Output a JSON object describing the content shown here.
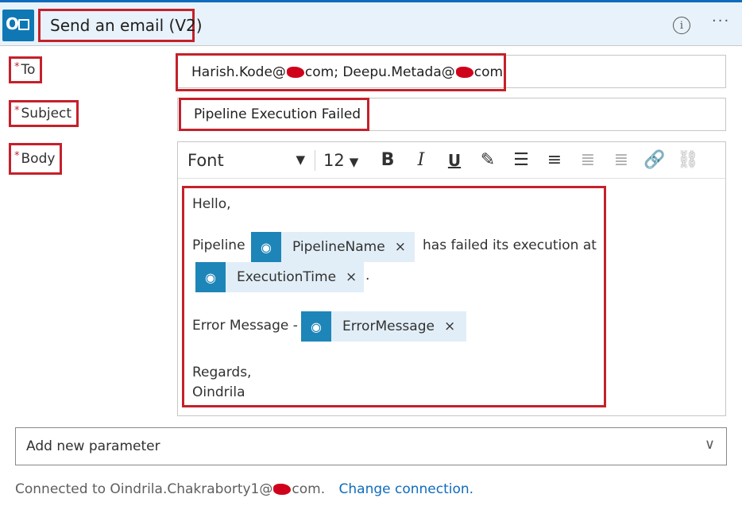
{
  "header": {
    "title": "Send an email (V2)",
    "app_icon": "outlook-icon",
    "info_glyph": "i",
    "more_glyph": "···"
  },
  "fields": {
    "to": {
      "label": "To",
      "required_mark": "*",
      "value_part1": "Harish.Kode@",
      "value_part2": "com; Deepu.Metada@",
      "value_part3": "com"
    },
    "subject": {
      "label": "Subject",
      "required_mark": "*",
      "value": "Pipeline Execution Failed"
    },
    "body": {
      "label": "Body",
      "required_mark": "*"
    }
  },
  "toolbar": {
    "font": "Font",
    "size": "12",
    "caret": "▼",
    "bold": "B",
    "italic": "I",
    "underline": "U",
    "pen": "✎",
    "bullets": "☰",
    "numbered": "≡",
    "outdent": "≣",
    "indent": "≣",
    "link": "🔗",
    "unlink": "⛓"
  },
  "body_content": {
    "greeting": "Hello,",
    "pipeline_prefix": "Pipeline",
    "pipeline_suffix": "has failed its execution at",
    "period": ".",
    "error_prefix": "Error Message -",
    "regards": "Regards,",
    "signature": "Oindrila",
    "tokens": {
      "pipeline_name": "PipelineName",
      "execution_time": "ExecutionTime",
      "error_message": "ErrorMessage",
      "remove_glyph": "×",
      "icon": "dynamic-content-icon"
    }
  },
  "add_parameter": {
    "placeholder": "Add new parameter",
    "chevron": "∨"
  },
  "footer": {
    "connected_prefix": "Connected to Oindrila.Chakraborty1@",
    "connected_suffix": "com.",
    "change_link": "Change connection."
  },
  "colors": {
    "highlight": "#c4212b",
    "accent": "#0f6cbd",
    "token_bg": "#e1eef8",
    "token_icon": "#1e85b8",
    "redaction": "#d0021b"
  }
}
